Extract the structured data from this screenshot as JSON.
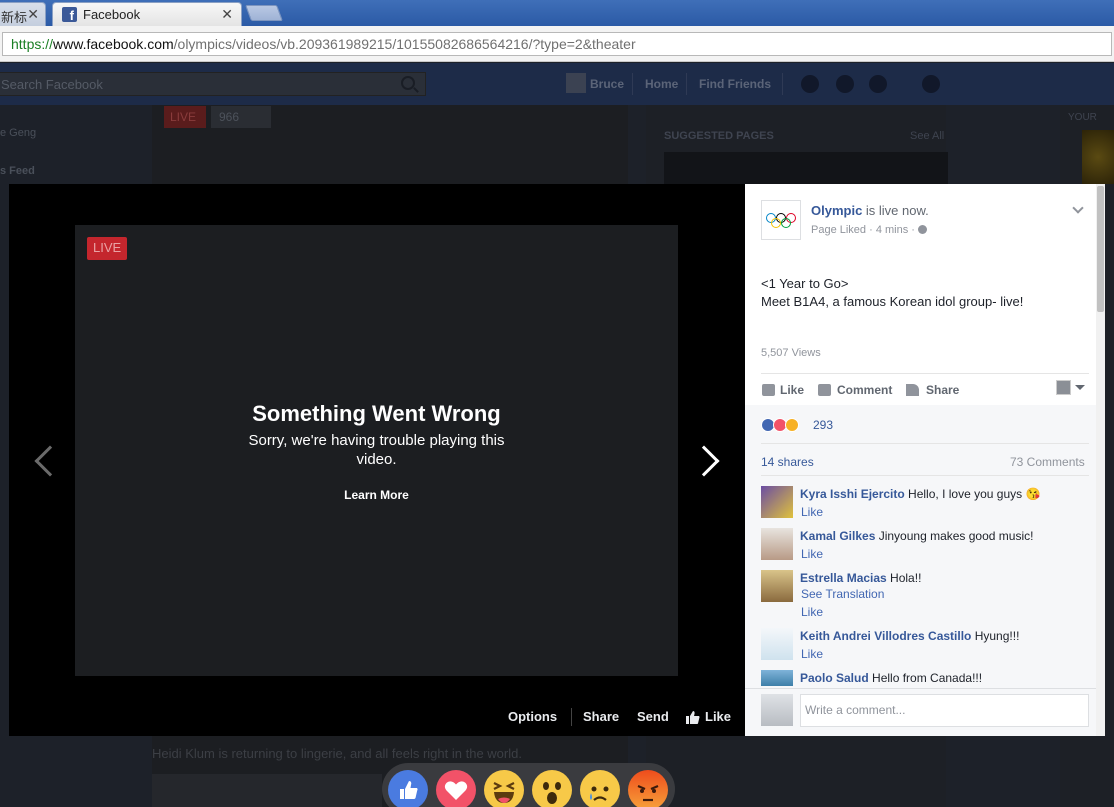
{
  "browser": {
    "tabs": [
      {
        "title": "新标",
        "close": "✕"
      },
      {
        "title": "Facebook",
        "close": "✕"
      }
    ],
    "url": {
      "scheme": "https://",
      "host": "www.facebook.com",
      "path": "/olympics/videos/vb.209361989215/10155082686564216/?type=2&theater"
    }
  },
  "fb_header": {
    "search_placeholder": "Search Facebook",
    "user_name": "Bruce",
    "home": "Home",
    "find_friends": "Find Friends"
  },
  "background_page": {
    "left_items": [
      "e Geng",
      "s Feed"
    ],
    "live_label": "LIVE",
    "view_count": "966",
    "suggested": "SUGGESTED PAGES",
    "see_all": "See All",
    "your": "YOUR",
    "caption": "Heidi Klum is returning to lingerie, and all feels right in the world."
  },
  "player": {
    "live_badge": "LIVE",
    "error_title": "Something Went Wrong",
    "error_sub": "Sorry, we're having trouble playing this video.",
    "learn_more": "Learn More",
    "bar": {
      "options": "Options",
      "share": "Share",
      "send": "Send",
      "like": "Like"
    }
  },
  "post": {
    "page_name": "Olympic",
    "status": " is live now.",
    "meta": "Page Liked · 4 mins ·",
    "text": "<1 Year to Go>\nMeet B1A4, a famous Korean idol group- live!",
    "views": "5,507 Views",
    "actions": {
      "like": "Like",
      "comment": "Comment",
      "share": "Share"
    },
    "reactions_count": "293",
    "shares": "14 shares",
    "comments_count": "73 Comments",
    "comments": [
      {
        "author": "Kyra Isshi Ejercito",
        "text": " Hello, I love you guys 😘",
        "like": "Like"
      },
      {
        "author": "Kamal Gilkes",
        "text": " Jinyoung makes good music!",
        "like": "Like"
      },
      {
        "author": "Estrella Macias",
        "text": " Hola!!",
        "translate": "See Translation",
        "like": "Like"
      },
      {
        "author": "Keith Andrei Villodres Castillo",
        "text": " Hyung!!!",
        "like": "Like"
      },
      {
        "author": "Paolo Salud",
        "text": " Hello from Canada!!!"
      }
    ],
    "comment_placeholder": "Write a comment..."
  },
  "colors": {
    "brand": "#3b5998",
    "link": "#365899",
    "live": "#c4262d"
  }
}
